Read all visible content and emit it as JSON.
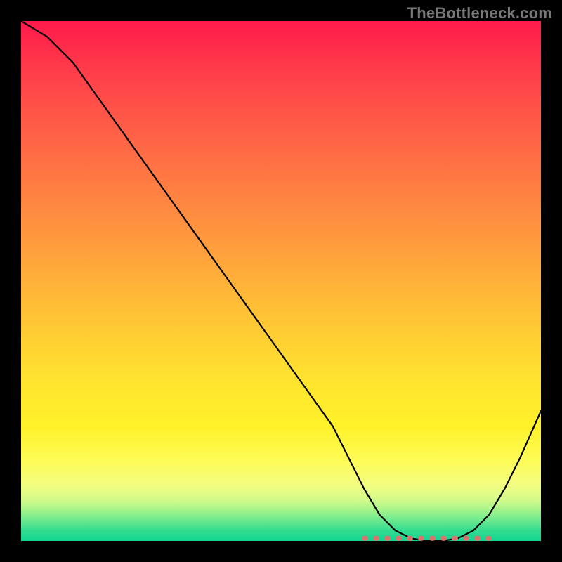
{
  "watermark": "TheBottleneck.com",
  "chart_data": {
    "type": "line",
    "title": "",
    "xlabel": "",
    "ylabel": "",
    "xlim": [
      0,
      100
    ],
    "ylim": [
      0,
      100
    ],
    "series": [
      {
        "name": "bottleneck-curve",
        "x": [
          0,
          5,
          10,
          15,
          20,
          25,
          30,
          35,
          40,
          45,
          50,
          55,
          60,
          63,
          66,
          69,
          72,
          75,
          78,
          81,
          84,
          87,
          90,
          93,
          96,
          100
        ],
        "y": [
          100,
          97,
          92,
          85,
          78,
          71,
          64,
          57,
          50,
          43,
          36,
          29,
          22,
          16,
          10,
          5,
          2,
          0.5,
          0,
          0,
          0.5,
          2,
          5,
          10,
          16,
          25
        ]
      }
    ],
    "annotations": [
      {
        "name": "optimal-range-dots",
        "x_start": 66,
        "x_end": 90,
        "y": 0.5
      }
    ],
    "background_gradient": {
      "stops": [
        {
          "pos": 0.0,
          "color": "#ff1a4b"
        },
        {
          "pos": 0.25,
          "color": "#ff6a45"
        },
        {
          "pos": 0.55,
          "color": "#ffbf36"
        },
        {
          "pos": 0.85,
          "color": "#fdfc5a"
        },
        {
          "pos": 1.0,
          "color": "#11d591"
        }
      ]
    }
  }
}
